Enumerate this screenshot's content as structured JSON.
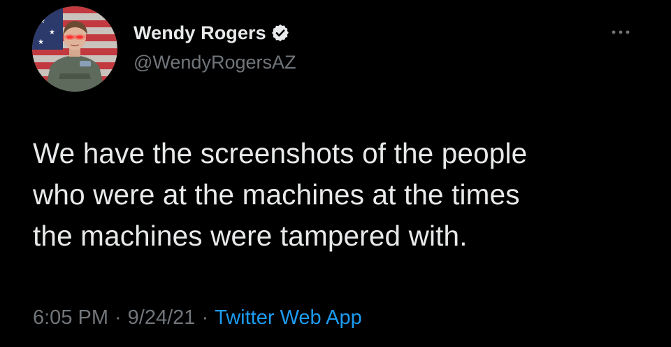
{
  "author": {
    "display_name": "Wendy Rogers",
    "handle": "@WendyRogersAZ",
    "verified": true,
    "verified_icon": "verified-badge-icon",
    "avatar_icon": "profile-avatar"
  },
  "tweet": {
    "text": "We have the screenshots of the people\nwho were at the machines at the times\nthe machines were tampered with."
  },
  "meta": {
    "time": "6:05 PM",
    "separator": "·",
    "date": "9/24/21",
    "source": "Twitter Web App"
  },
  "menu": {
    "icon": "more-options-icon"
  },
  "colors": {
    "background": "#000000",
    "text_primary": "#e7e9ea",
    "text_secondary": "#71767b",
    "link": "#1d9bf0"
  }
}
